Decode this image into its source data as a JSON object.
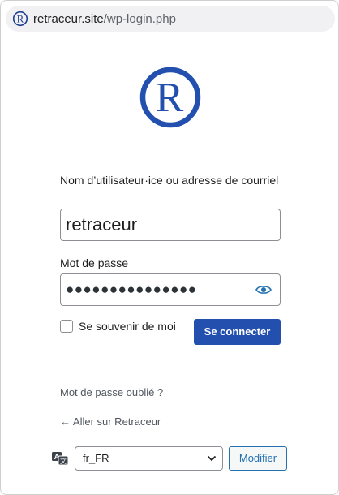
{
  "browser": {
    "url_host": "retraceur.site",
    "url_path": "/wp-login.php",
    "site_icon": "retraceur-r-logo-icon"
  },
  "logo": {
    "icon": "retraceur-r-logo-icon",
    "letter": "R",
    "color": "#2350ae"
  },
  "form": {
    "username_label": "Nom d’utilisateur·ice ou adresse de courriel",
    "username_value": "retraceur",
    "password_label": "Mot de passe",
    "password_mask": "●●●●●●●●●●●●●●●",
    "password_toggle_icon": "eye-icon",
    "remember_label": "Se souvenir de moi",
    "remember_checked": false,
    "submit_label": "Se connecter"
  },
  "links": {
    "lost_password": "Mot de passe oublié ?",
    "back_to_site": "← Aller sur Retraceur"
  },
  "language": {
    "icon": "translate-icon",
    "selected": "fr_FR",
    "change_label": "Modifier"
  },
  "colors": {
    "primary": "#2350ae",
    "link_blue": "#2271b1",
    "text": "#1e1e1e",
    "muted": "#50575e"
  }
}
